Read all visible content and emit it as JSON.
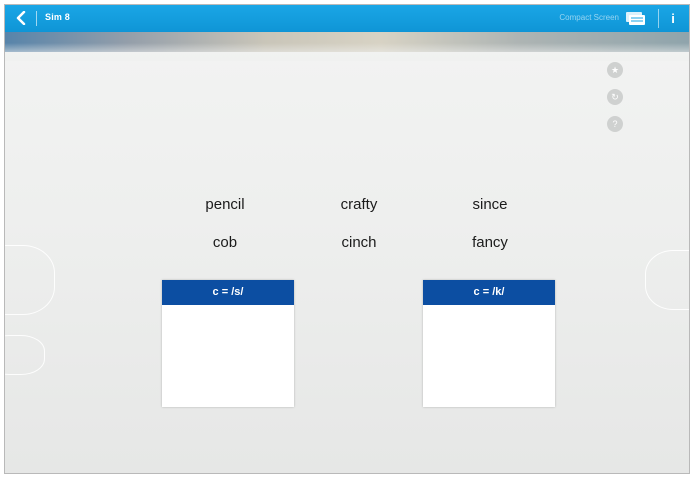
{
  "app": {
    "title": "Sim 8",
    "right_text": "Compact Screen"
  },
  "icons": {
    "back": "chevron-left-icon",
    "flashcards": "flashcards-icon",
    "info": "info-icon",
    "tools": [
      "star-icon",
      "refresh-icon",
      "help-icon"
    ]
  },
  "info_label": "i",
  "words": {
    "row1": [
      "pencil",
      "crafty",
      "since"
    ],
    "row2": [
      "cob",
      "cinch",
      "fancy"
    ]
  },
  "categories": [
    {
      "label": "c = /s/"
    },
    {
      "label": "c = /k/"
    }
  ],
  "colors": {
    "topbar": "#1aa6e6",
    "category_header": "#0c4ea2"
  }
}
